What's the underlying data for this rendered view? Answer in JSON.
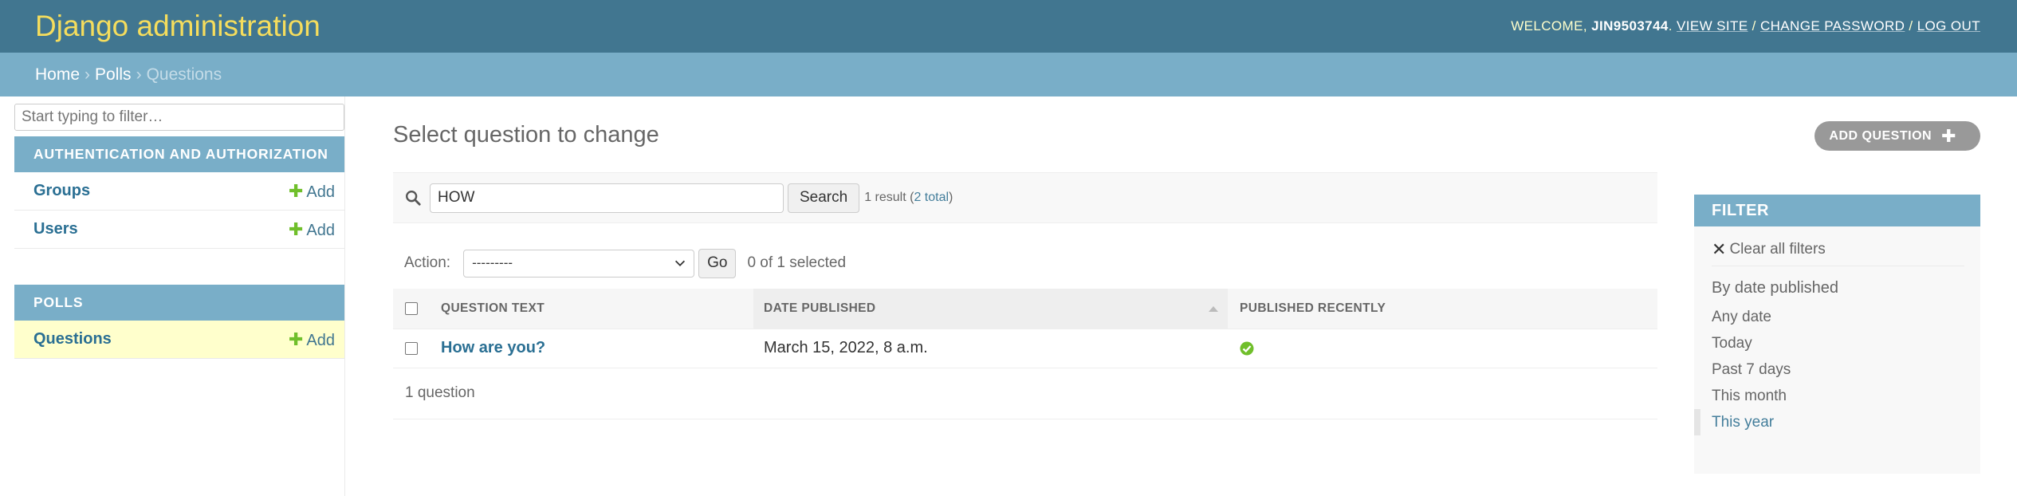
{
  "header": {
    "site_name": "Django administration",
    "welcome": "WELCOME, ",
    "username": "JIN9503744",
    "period": ".",
    "view_site": "VIEW SITE",
    "change_password": "CHANGE PASSWORD",
    "log_out": "LOG OUT",
    "separator": " / "
  },
  "breadcrumbs": {
    "home": "Home",
    "polls": "Polls",
    "current": "Questions",
    "sep": "›"
  },
  "sidebar": {
    "filter_placeholder": "Start typing to filter…",
    "add_label": "Add",
    "apps": [
      {
        "caption": "AUTHENTICATION AND AUTHORIZATION",
        "models": [
          "Groups",
          "Users"
        ]
      },
      {
        "caption": "POLLS",
        "models": [
          "Questions"
        ]
      }
    ]
  },
  "content": {
    "title": "Select question to change",
    "add_button": "ADD QUESTION",
    "search_value": "HOW",
    "search_button": "Search",
    "result_prefix": "1 result (",
    "result_total": "2 total",
    "result_suffix": ")",
    "action_label": "Action:",
    "action_selected": "---------",
    "go_button": "Go",
    "selected_counter": "0 of 1 selected",
    "columns": [
      "QUESTION TEXT",
      "DATE PUBLISHED",
      "PUBLISHED RECENTLY"
    ],
    "rows": [
      {
        "question": "How are you?",
        "date": "March 15, 2022, 8 a.m.",
        "published_recently": true
      }
    ],
    "paginator": "1 question"
  },
  "filter": {
    "title": "FILTER",
    "clear": "Clear all filters",
    "heading": "By date published",
    "options": [
      "Any date",
      "Today",
      "Past 7 days",
      "This month",
      "This year"
    ],
    "selected": "This year"
  },
  "colors": {
    "header_bg": "#417690",
    "breadcrumbs_bg": "#79aec8",
    "brand_yellow": "#f5dd5d",
    "link": "#2a6f93",
    "add_green": "#70bf2b"
  }
}
